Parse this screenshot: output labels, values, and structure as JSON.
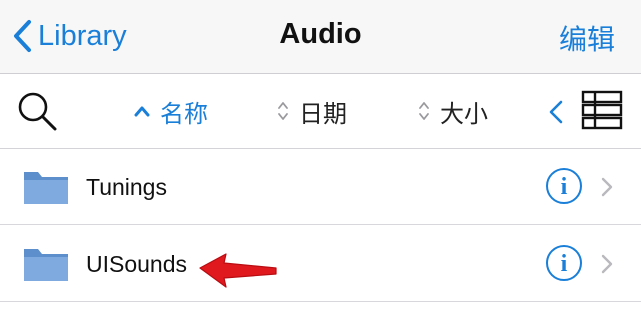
{
  "navbar": {
    "back_label": "Library",
    "title": "Audio",
    "edit_label": "编辑"
  },
  "sortbar": {
    "sorts": [
      {
        "label": "名称",
        "active": true
      },
      {
        "label": "日期",
        "active": false
      },
      {
        "label": "大小",
        "active": false
      }
    ]
  },
  "items": [
    {
      "name": "Tunings",
      "icon": "folder-icon"
    },
    {
      "name": "UISounds",
      "icon": "folder-icon"
    }
  ],
  "colors": {
    "accent": "#1a7fd8",
    "folder": "#6fa0d8",
    "annotation_arrow": "#e0191e"
  }
}
